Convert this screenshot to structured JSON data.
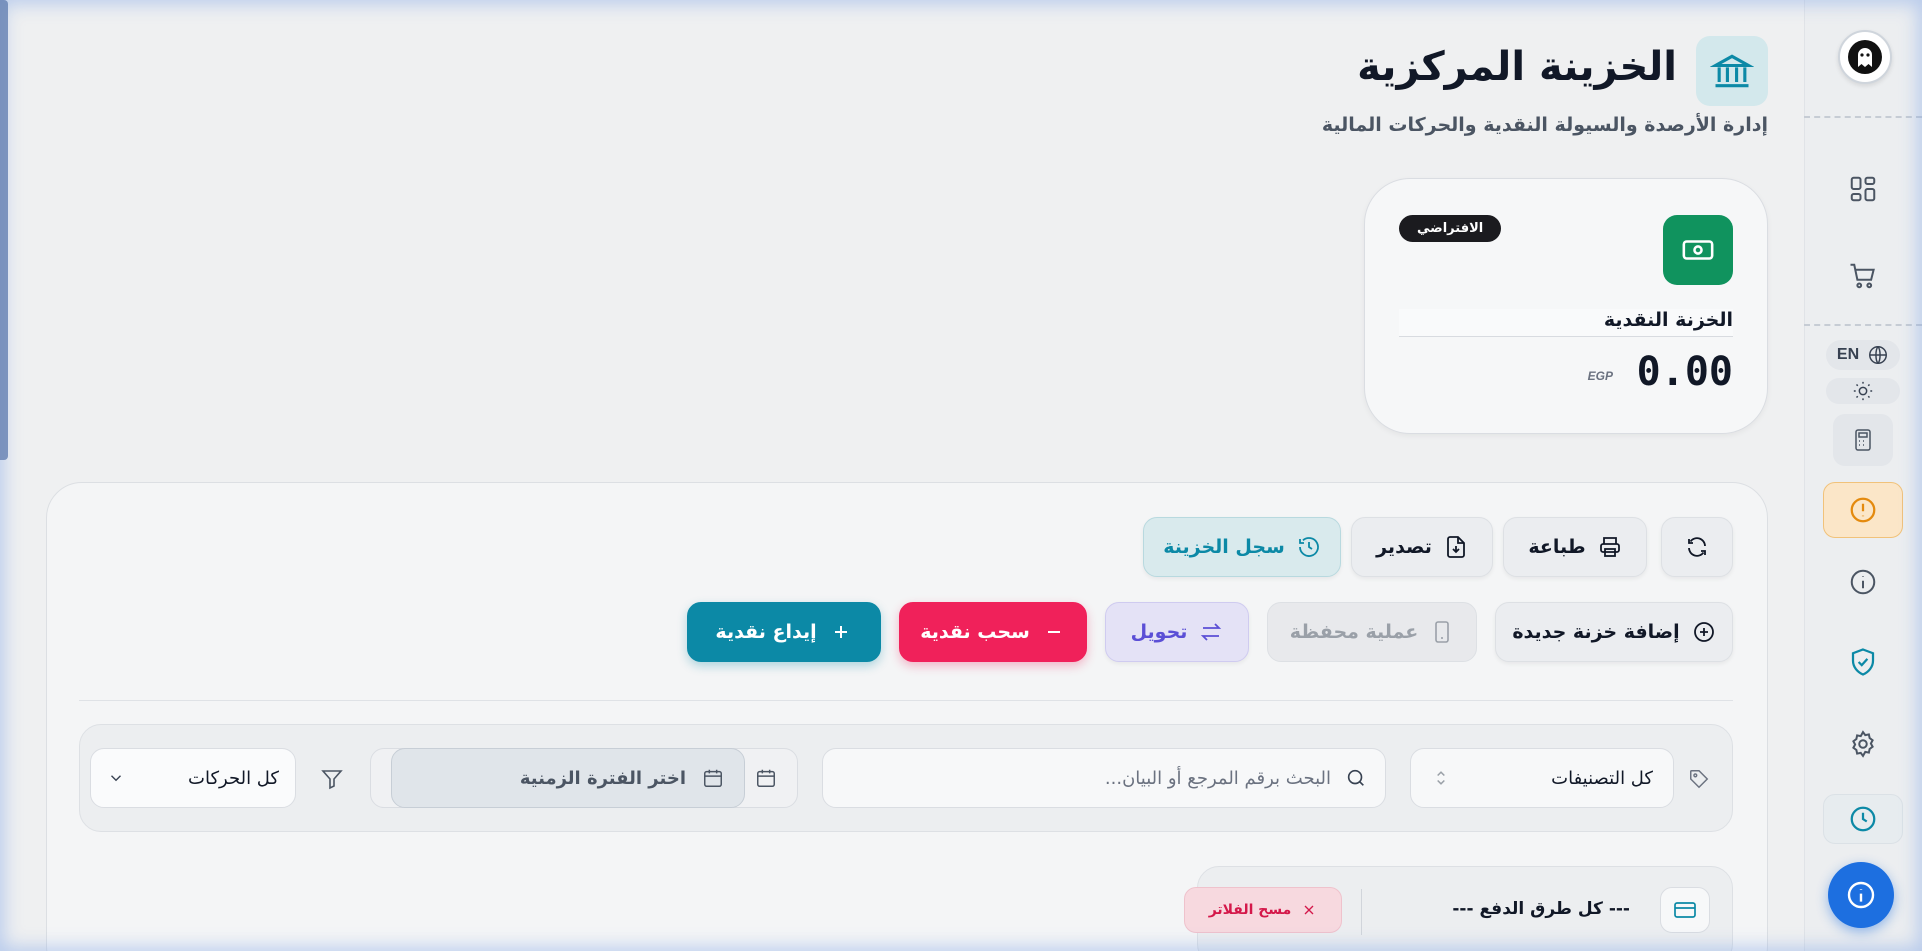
{
  "header": {
    "title": "الخزينة المركزية",
    "subtitle": "إدارة الأرصدة والسيولة النقدية والحركات المالية"
  },
  "treasury_card": {
    "badge": "الافتراضي",
    "name": "الخزنة النقدية",
    "amount": "0.00",
    "currency": "EGP"
  },
  "toolbar": {
    "refresh_icon": "refresh-icon",
    "print_label": "طباعة",
    "export_label": "تصدير",
    "log_label": "سجل الخزينة"
  },
  "actions": {
    "add_treasury_label": "إضافة خزنة جديدة",
    "wallet_label": "عملية محفظة",
    "transfer_label": "تحويل",
    "withdraw_label": "سحب نقدية",
    "deposit_label": "إيداع نقدية"
  },
  "filters": {
    "categories": "كل التصنيفات",
    "search_placeholder": "البحث برقم المرجع أو البيان...",
    "period": "اختر الفترة الزمنية",
    "movements": "كل الحركات",
    "payment_methods": "--- كل طرق الدفع ---",
    "clear_label": "مسح الفلاتر"
  },
  "rail": {
    "lang": "EN"
  },
  "colors": {
    "primary_teal": "#0c89a6",
    "danger": "#f0215a",
    "success": "#10935e",
    "transfer_bg": "#e4e2f6",
    "help_blue": "#1d6fe0"
  }
}
